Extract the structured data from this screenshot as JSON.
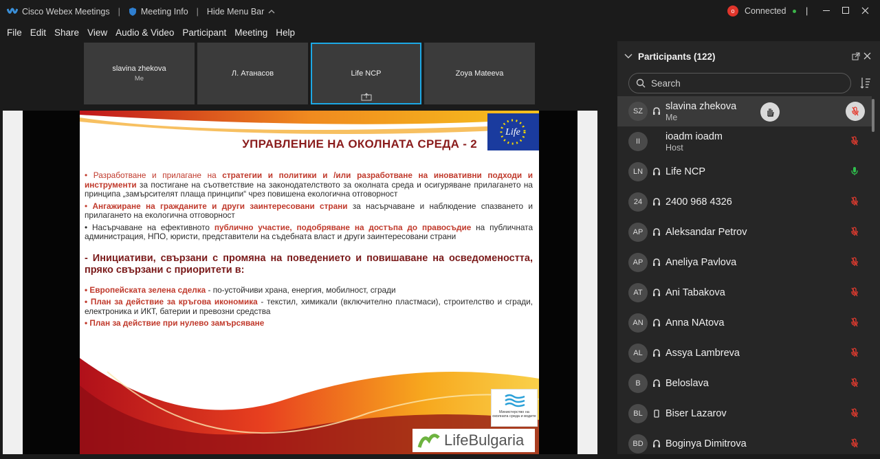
{
  "titlebar": {
    "app_name": "Cisco Webex Meetings",
    "meeting_info": "Meeting Info",
    "hide_menu": "Hide Menu Bar",
    "status": "Connected",
    "status_color": "#3bb54a"
  },
  "menu": [
    "File",
    "Edit",
    "Share",
    "View",
    "Audio & Video",
    "Participant",
    "Meeting",
    "Help"
  ],
  "thumbnails": [
    {
      "name": "slavina zhekova",
      "sub": "Me"
    },
    {
      "name": "Л. Атанасов",
      "sub": ""
    },
    {
      "name": "Life NCP",
      "sub": ""
    },
    {
      "name": "Zoya Mateeva",
      "sub": ""
    }
  ],
  "slide": {
    "title": "УПРАВЛЕНИЕ НА ОКОЛНАТА СРЕДА - 2",
    "p1_a": "• Разработване и прилагане на ",
    "p1_b": "стратегии и политики и   /или разработване на иновативни подходи и инструменти",
    "p1_c": " за постигане на съответствие на законодателството за околната среда и осигуряване прилагането на принципа „замърсителят плаща принципи“ чрез повишена екологична отговорност",
    "p2_a": "• ",
    "p2_b": "Ангажиране на гражданите и други заинтересовани страни",
    "p2_c": " за насърчаване и наблюдение спазването и прилагането на екологична отговорност",
    "p3_a": "• Насърчаване на ефективното ",
    "p3_b": "публично участие, подобряване на достъпа до правосъдие",
    "p3_c": " на публичната администрация, НПО, юристи, представители на съдебната власт и други заинтересовани страни",
    "lead": "- Инициативи, свързани с промяна на поведението и повишаване на осведомеността, пряко свързани с приоритети в:",
    "b1_a": "• Европейската зелена сделка",
    "b1_b": "  -  по-устойчиви храна, енергия, мобилност, сгради",
    "b2_a": "• План за действие за кръгова икономика",
    "b2_b": " - текстил, химикали (включително пластмаси), строителство и сгради, електроника и ИКТ,  батерии и превозни средства",
    "b3": "• План за действие при нулево замърсяване",
    "eu_logo": "Life",
    "ministry": "Министерство на околната среда и водите",
    "lifebulgaria": "LifeBulgaria"
  },
  "panel": {
    "title": "Participants (122)",
    "search_placeholder": "Search",
    "participants": [
      {
        "initials": "SZ",
        "name": "slavina zhekova",
        "role": "Me",
        "device": "headset",
        "mic": "muted-circle",
        "hand": true
      },
      {
        "initials": "II",
        "name": "ioadm ioadm",
        "role": "Host",
        "device": "",
        "mic": "muted"
      },
      {
        "initials": "LN",
        "name": "Life NCP",
        "role": "",
        "device": "headset",
        "mic": "active"
      },
      {
        "initials": "24",
        "name": "2400 968 4326",
        "role": "",
        "device": "headset",
        "mic": "muted"
      },
      {
        "initials": "AP",
        "name": "Aleksandar Petrov",
        "role": "",
        "device": "headset",
        "mic": "muted"
      },
      {
        "initials": "AP",
        "name": "Aneliya Pavlova",
        "role": "",
        "device": "headset",
        "mic": "muted"
      },
      {
        "initials": "AT",
        "name": "Ani Tabakova",
        "role": "",
        "device": "headset",
        "mic": "muted"
      },
      {
        "initials": "AN",
        "name": "Anna NAtova",
        "role": "",
        "device": "headset",
        "mic": "muted"
      },
      {
        "initials": "AL",
        "name": "Assya Lambreva",
        "role": "",
        "device": "headset",
        "mic": "muted"
      },
      {
        "initials": "B",
        "name": "Beloslava",
        "role": "",
        "device": "headset",
        "mic": "muted"
      },
      {
        "initials": "BL",
        "name": "Biser Lazarov",
        "role": "",
        "device": "phone",
        "mic": "muted"
      },
      {
        "initials": "BD",
        "name": "Boginya Dimitrova",
        "role": "",
        "device": "headset",
        "mic": "muted"
      }
    ]
  }
}
